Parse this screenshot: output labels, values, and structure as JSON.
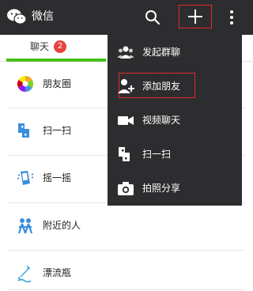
{
  "topbar": {
    "title": "微信",
    "logo_icon": "wechat-logo-icon",
    "search_icon": "search-icon",
    "plus_icon": "plus-icon",
    "more_icon": "more-vertical-icon"
  },
  "tabs": {
    "chat_label": "聊天",
    "chat_badge": "2",
    "active_color": "#45c01a"
  },
  "discover": {
    "items": [
      {
        "label": "朋友圈",
        "icon": "moments-icon"
      },
      {
        "label": "扫一扫",
        "icon": "scan-icon"
      },
      {
        "label": "摇一摇",
        "icon": "shake-icon"
      },
      {
        "label": "附近的人",
        "icon": "people-nearby-icon"
      },
      {
        "label": "漂流瓶",
        "icon": "drift-bottle-icon"
      }
    ]
  },
  "dropdown": {
    "items": [
      {
        "label": "发起群聊",
        "icon": "group-chat-icon"
      },
      {
        "label": "添加朋友",
        "icon": "add-friend-icon"
      },
      {
        "label": "视频聊天",
        "icon": "video-chat-icon"
      },
      {
        "label": "扫一扫",
        "icon": "scan-icon"
      },
      {
        "label": "拍照分享",
        "icon": "camera-icon"
      }
    ]
  },
  "colors": {
    "bar": "#2d2d30",
    "annotation_red": "#e02a2a",
    "badge": "#e64340"
  }
}
